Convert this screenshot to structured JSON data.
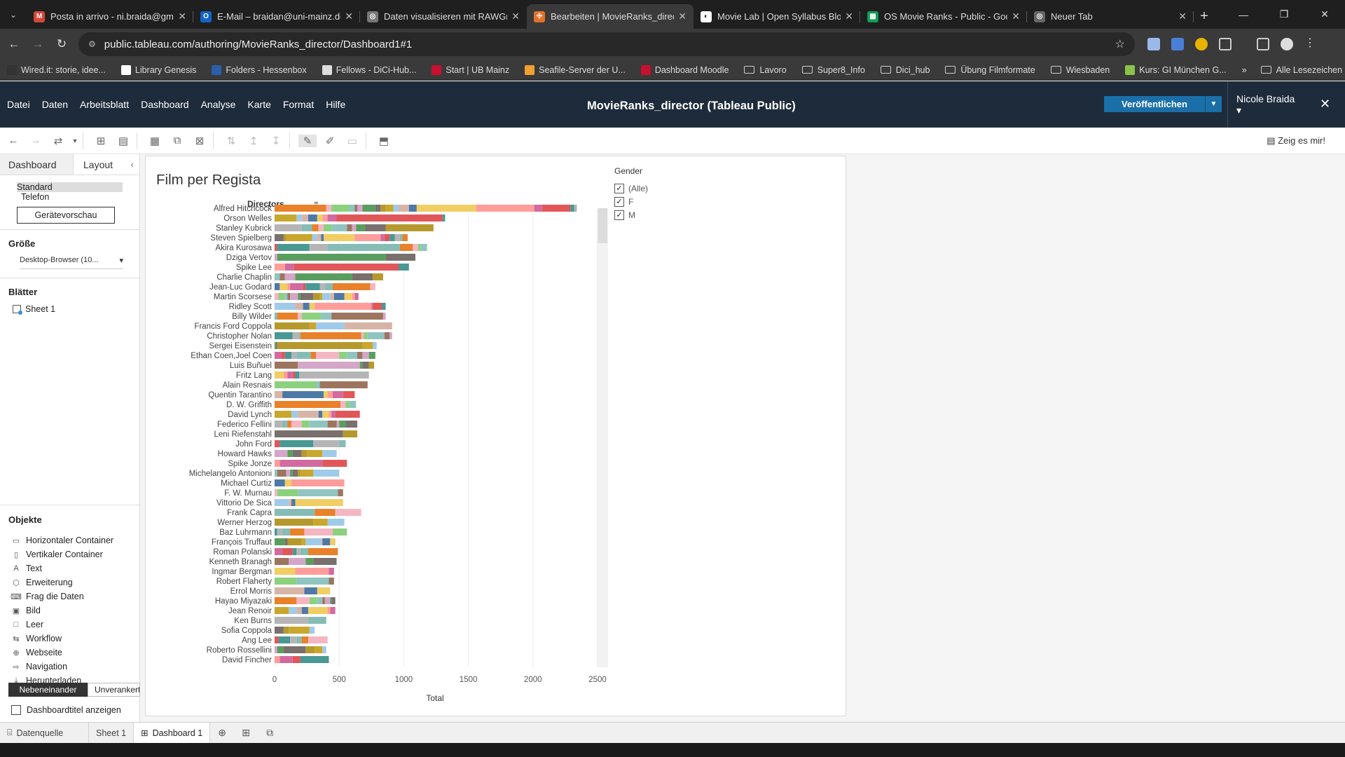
{
  "browser": {
    "tabs": [
      {
        "title": "Posta in arrivo - ni.braida@gma",
        "icon_color": "#d44638",
        "icon_glyph": "M"
      },
      {
        "title": "E-Mail – braidan@uni-mainz.de",
        "icon_color": "#1364c5",
        "icon_glyph": "O"
      },
      {
        "title": "Daten visualisieren mit RAWGra",
        "icon_color": "#777777",
        "icon_glyph": "◎"
      },
      {
        "title": "Bearbeiten | MovieRanks_direct",
        "icon_color": "#e5702a",
        "icon_glyph": "✣"
      },
      {
        "title": "Movie Lab | Open Syllabus Blog",
        "icon_color": "#ffffff",
        "icon_glyph": "◐"
      },
      {
        "title": "OS Movie Ranks - Public - Goo",
        "icon_color": "#0f9d58",
        "icon_glyph": "▦"
      },
      {
        "title": "Neuer Tab",
        "icon_color": "#666666",
        "icon_glyph": "◎"
      }
    ],
    "url": "public.tableau.com/authoring/MovieRanks_director/Dashboard1#1",
    "bookmarks": [
      {
        "label": "Wired.it: storie, idee...",
        "color": "#333333",
        "folder": false
      },
      {
        "label": "Library Genesis",
        "color": "#ffffff",
        "folder": false
      },
      {
        "label": "Folders - Hessenbox",
        "color": "#2b5fa8",
        "folder": false
      },
      {
        "label": "Fellows - DiCi-Hub...",
        "color": "#dddddd",
        "folder": false
      },
      {
        "label": "Start | UB Mainz",
        "color": "#c8102e",
        "folder": false
      },
      {
        "label": "Seafile-Server der U...",
        "color": "#f0a030",
        "folder": false
      },
      {
        "label": "Dashboard Moodle",
        "color": "#c8102e",
        "folder": false
      },
      {
        "label": "Lavoro",
        "color": "",
        "folder": true
      },
      {
        "label": "Super8_Info",
        "color": "",
        "folder": true
      },
      {
        "label": "Dici_hub",
        "color": "",
        "folder": true
      },
      {
        "label": "Übung Filmformate",
        "color": "",
        "folder": true
      },
      {
        "label": "Wiesbaden",
        "color": "",
        "folder": true
      },
      {
        "label": "Kurs: GI München G...",
        "color": "#8bc34a",
        "folder": false
      }
    ],
    "more_bookmarks": "»",
    "all_bookmarks": "Alle Lesezeichen"
  },
  "tableau": {
    "menu": [
      "Datei",
      "Daten",
      "Arbeitsblatt",
      "Dashboard",
      "Analyse",
      "Karte",
      "Format",
      "Hilfe"
    ],
    "title": "MovieRanks_director (Tableau Public)",
    "publish": "Veröffentlichen",
    "user": "Nicole Braida ▾",
    "show_me": "Zeig es mir!"
  },
  "left_pane": {
    "tab_dashboard": "Dashboard",
    "tab_layout": "Layout",
    "device_standard": "Standard",
    "device_phone": "Telefon",
    "device_preview": "Gerätevorschau",
    "size_heading": "Größe",
    "size_value": "Desktop-Browser (10...",
    "sheets_heading": "Blätter",
    "sheet_1": "Sheet 1",
    "objects_heading": "Objekte",
    "objects": [
      {
        "label": "Horizontaler Container",
        "icon": "▭"
      },
      {
        "label": "Vertikaler Container",
        "icon": "▯"
      },
      {
        "label": "Text",
        "icon": "A"
      },
      {
        "label": "Erweiterung",
        "icon": "⬡"
      },
      {
        "label": "Frag die Daten",
        "icon": "⌨"
      },
      {
        "label": "Bild",
        "icon": "▣"
      },
      {
        "label": "Leer",
        "icon": "□"
      },
      {
        "label": "Workflow",
        "icon": "⇆"
      },
      {
        "label": "Webseite",
        "icon": "⊕"
      },
      {
        "label": "Navigation",
        "icon": "⇨"
      },
      {
        "label": "Herunterladen",
        "icon": "⤓"
      }
    ],
    "tiled": "Nebeneinander",
    "floating": "Unverankert",
    "show_dashboard_title": "Dashboardtitel anzeigen"
  },
  "dashboard": {
    "legend_title": "Gender",
    "legend_items": [
      "(Alle)",
      "F",
      "M"
    ]
  },
  "bottom": {
    "data_source": "Datenquelle",
    "sheet": "Sheet 1",
    "dashboard": "Dashboard 1"
  },
  "chart_data": {
    "type": "bar",
    "title": "Film per Regista",
    "xlabel": "Total",
    "ylabel": "Directors",
    "xlim": [
      0,
      2500
    ],
    "xticks": [
      0,
      500,
      1000,
      1500,
      2000,
      2500
    ],
    "grid": true,
    "stacked": true,
    "categories": [
      "Alfred Hitchcock",
      "Orson Welles",
      "Stanley Kubrick",
      "Steven Spielberg",
      "Akira Kurosawa",
      "Dziga Vertov",
      "Spike Lee",
      "Charlie Chaplin",
      "Jean-Luc Godard",
      "Martin Scorsese",
      "Ridley Scott",
      "Billy Wilder",
      "Francis Ford Coppola",
      "Christopher Nolan",
      "Sergei Eisenstein",
      "Ethan Coen,Joel Coen",
      "Luis Buñuel",
      "Fritz Lang",
      "Alain Resnais",
      "Quentin Tarantino",
      "D. W. Griffith",
      "David Lynch",
      "Federico Fellini",
      "Leni Riefenstahl",
      "John Ford",
      "Howard Hawks",
      "Spike Jonze",
      "Michelangelo Antonioni",
      "Michael Curtiz",
      "F. W. Murnau",
      "Vittorio De Sica",
      "Frank Capra",
      "Werner Herzog",
      "Baz Luhrmann",
      "François Truffaut",
      "Roman Polanski",
      "Kenneth Branagh",
      "Ingmar Bergman",
      "Robert Flaherty",
      "Errol Morris",
      "Hayao Miyazaki",
      "Jean Renoir",
      "Ken Burns",
      "Sofia Coppola",
      "Ang Lee",
      "Roberto Rossellini",
      "David Fincher"
    ],
    "segments": [
      [
        400,
        40,
        140,
        40,
        20,
        40,
        100,
        40,
        40,
        60,
        40,
        80,
        60,
        460,
        450,
        60,
        220,
        30,
        20
      ],
      [
        170,
        40,
        50,
        70,
        40,
        40,
        70,
        820,
        20
      ],
      [
        210,
        80,
        50,
        40,
        60,
        120,
        40,
        30,
        70,
        160,
        370
      ],
      [
        70,
        20,
        200,
        40,
        30,
        20,
        240,
        200,
        30,
        40,
        40,
        40,
        20,
        40
      ],
      [
        20,
        250,
        140,
        560,
        100,
        40,
        20,
        50
      ],
      [
        20,
        840,
        230
      ],
      [
        80,
        70,
        810,
        80
      ],
      [
        40,
        40,
        80,
        440,
        160,
        80
      ],
      [
        40,
        60,
        20,
        100,
        20,
        110,
        40,
        60,
        290,
        40
      ],
      [
        30,
        50,
        20,
        20,
        60,
        20,
        100,
        50,
        20,
        60,
        30,
        80,
        60,
        20,
        30
      ],
      [
        160,
        60,
        50,
        40,
        440,
        10,
        70,
        30
      ],
      [
        20,
        160,
        30,
        150,
        80,
        400,
        20
      ],
      [
        270,
        50,
        220,
        370
      ],
      [
        140,
        50,
        10,
        470,
        20,
        30,
        130,
        40,
        20
      ],
      [
        10,
        10,
        660,
        80,
        30
      ],
      [
        50,
        30,
        50,
        40,
        110,
        40,
        180,
        60,
        80,
        40,
        50,
        50
      ],
      [
        180,
        480,
        20,
        50,
        40
      ],
      [
        70,
        30,
        40,
        20,
        30,
        540
      ],
      [
        320,
        30,
        370
      ],
      [
        60,
        320,
        30,
        40,
        80,
        90
      ],
      [
        510,
        40,
        30,
        50
      ],
      [
        130,
        50,
        160,
        30,
        50,
        20,
        30,
        190
      ],
      [
        60,
        40,
        30,
        80,
        60,
        140,
        70,
        20,
        50,
        90
      ],
      [
        530,
        110
      ],
      [
        40,
        260,
        200,
        50
      ],
      [
        100,
        40,
        70,
        40,
        120,
        110
      ],
      [
        40,
        330,
        190
      ],
      [
        20,
        70,
        30,
        20,
        40,
        20,
        100,
        200
      ],
      [
        80,
        50,
        410
      ],
      [
        20,
        160,
        310,
        40
      ],
      [
        110,
        20,
        30,
        370
      ],
      [
        310,
        160,
        200
      ],
      [
        300,
        110,
        130
      ],
      [
        20,
        40,
        60,
        110,
        220,
        110
      ],
      [
        80,
        20,
        110,
        30,
        120,
        10,
        60,
        40
      ],
      [
        60,
        80,
        30,
        30,
        60,
        230
      ],
      [
        110,
        130,
        60,
        180
      ],
      [
        160,
        260,
        40
      ],
      [
        170,
        250,
        40
      ],
      [
        230,
        100,
        100
      ],
      [
        170,
        100,
        60,
        40,
        20,
        40,
        10,
        30
      ],
      [
        110,
        60,
        40,
        50,
        150,
        20,
        40
      ],
      [
        260,
        140
      ],
      [
        70,
        40,
        160,
        40
      ],
      [
        30,
        90,
        50,
        40,
        50,
        150
      ],
      [
        20,
        50,
        170,
        70,
        60,
        30
      ],
      [
        40,
        100,
        60,
        220
      ]
    ]
  },
  "palette": [
    "#e8812a",
    "#8fc4c0",
    "#5a9e5f",
    "#c9a72d",
    "#4e79a7",
    "#d16a9f",
    "#b5b5b5",
    "#f4b6c2",
    "#9c755f",
    "#79706e",
    "#a0cbe8",
    "#f1ce63",
    "#e15759",
    "#86bcb6",
    "#8cd17d",
    "#d4a6c8",
    "#b6992d",
    "#d7b5a6",
    "#ff9d9a",
    "#499894"
  ]
}
